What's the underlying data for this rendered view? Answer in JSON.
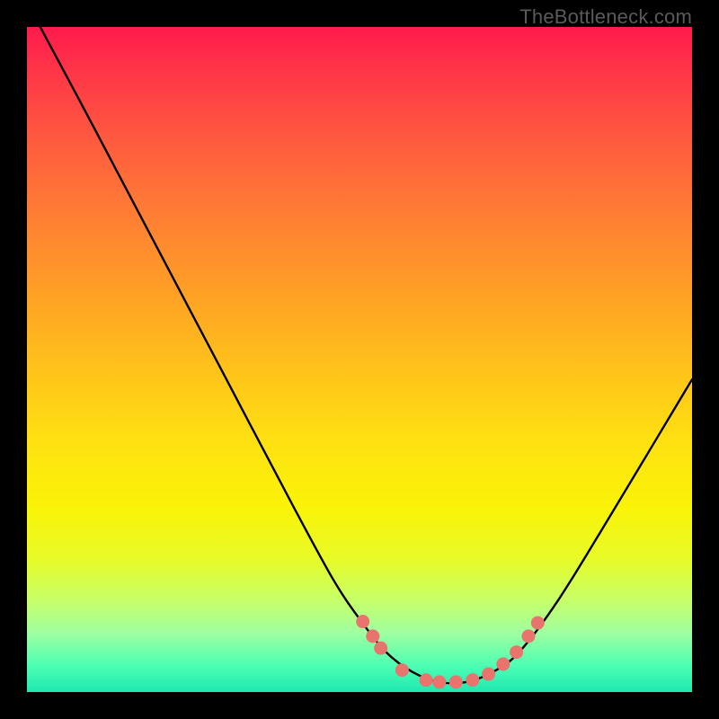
{
  "watermark": "TheBottleneck.com",
  "chart_data": {
    "type": "line",
    "title": "",
    "xlabel": "",
    "ylabel": "",
    "xlim": [
      0,
      100
    ],
    "ylim": [
      0,
      100
    ],
    "series": [
      {
        "name": "bottleneck-curve",
        "x": [
          2,
          10,
          20,
          30,
          40,
          46,
          50,
          54,
          58,
          62,
          66,
          70,
          74,
          80,
          88,
          100
        ],
        "y": [
          100,
          85,
          66,
          47,
          28,
          17,
          11,
          6,
          3,
          1.5,
          1.5,
          3,
          6,
          14,
          27,
          47
        ]
      }
    ],
    "markers": {
      "name": "highlighted-points",
      "color": "#e9746e",
      "points": [
        {
          "x": 50.5,
          "y": 10.6
        },
        {
          "x": 52.0,
          "y": 8.4
        },
        {
          "x": 53.2,
          "y": 6.6
        },
        {
          "x": 56.4,
          "y": 3.3
        },
        {
          "x": 60.0,
          "y": 1.8
        },
        {
          "x": 62.0,
          "y": 1.5
        },
        {
          "x": 64.5,
          "y": 1.5
        },
        {
          "x": 67.0,
          "y": 1.8
        },
        {
          "x": 69.4,
          "y": 2.7
        },
        {
          "x": 71.6,
          "y": 4.2
        },
        {
          "x": 73.6,
          "y": 6.0
        },
        {
          "x": 75.4,
          "y": 8.4
        },
        {
          "x": 76.8,
          "y": 10.4
        }
      ]
    }
  }
}
